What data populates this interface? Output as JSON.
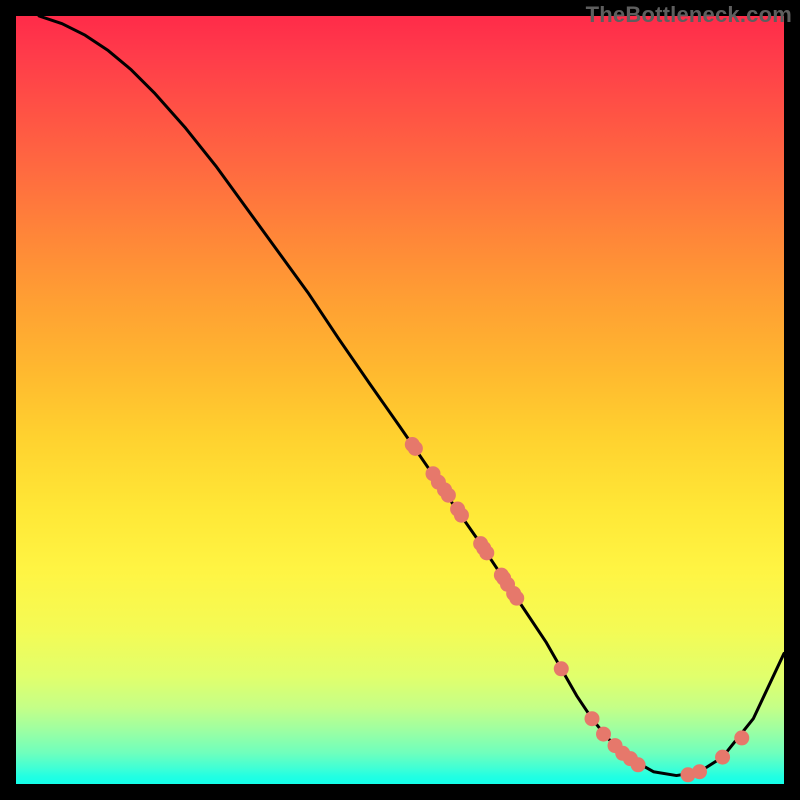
{
  "watermark": "TheBottleneck.com",
  "chart_data": {
    "type": "line",
    "title": "",
    "xlabel": "",
    "ylabel": "",
    "xlim": [
      0,
      100
    ],
    "ylim": [
      0,
      100
    ],
    "grid": false,
    "legend": false,
    "curve_x": [
      3,
      6,
      9,
      12,
      15,
      18,
      22,
      26,
      30,
      34,
      38,
      42,
      46,
      50,
      54,
      57,
      60,
      63,
      66,
      69,
      71,
      73,
      75,
      77,
      80,
      83,
      86,
      89,
      92,
      96,
      100
    ],
    "curve_bottleneck": [
      100,
      99,
      97.5,
      95.5,
      93,
      90,
      85.5,
      80.5,
      75,
      69.5,
      64,
      58,
      52.2,
      46.5,
      40.7,
      36.3,
      32,
      27.5,
      23,
      18.5,
      15,
      11.5,
      8.5,
      6,
      3.3,
      1.6,
      1.1,
      1.6,
      3.5,
      8.5,
      17
    ],
    "scatter_x": [
      51.6,
      52.0,
      54.3,
      55.0,
      55.8,
      56.3,
      57.5,
      58.0,
      60.5,
      60.9,
      61.3,
      63.2,
      63.5,
      64.0,
      64.8,
      65.2,
      71.0,
      75.0,
      76.5,
      78.0,
      79.0,
      80.0,
      81.0,
      87.5,
      89.0,
      92.0,
      94.5
    ],
    "scatter_bottleneck": [
      44.2,
      43.7,
      40.4,
      39.3,
      38.3,
      37.6,
      35.8,
      35.0,
      31.3,
      30.7,
      30.1,
      27.2,
      26.8,
      26.0,
      24.8,
      24.2,
      15.0,
      8.5,
      6.5,
      5.0,
      4.0,
      3.3,
      2.5,
      1.2,
      1.6,
      3.5,
      6.0
    ],
    "colors": {
      "curve": "#000000",
      "scatter": "#e6786b",
      "gradient_top": "#ff2b49",
      "gradient_bottom": "#14ffea",
      "background": "#000000"
    },
    "description": "Bottleneck percentage curve over a gradient heat background. Curve descends steeply from top-left to a minimum near x≈86 then rises sharply toward the right. Salmon scatter points lie along the lower half of the curve."
  }
}
